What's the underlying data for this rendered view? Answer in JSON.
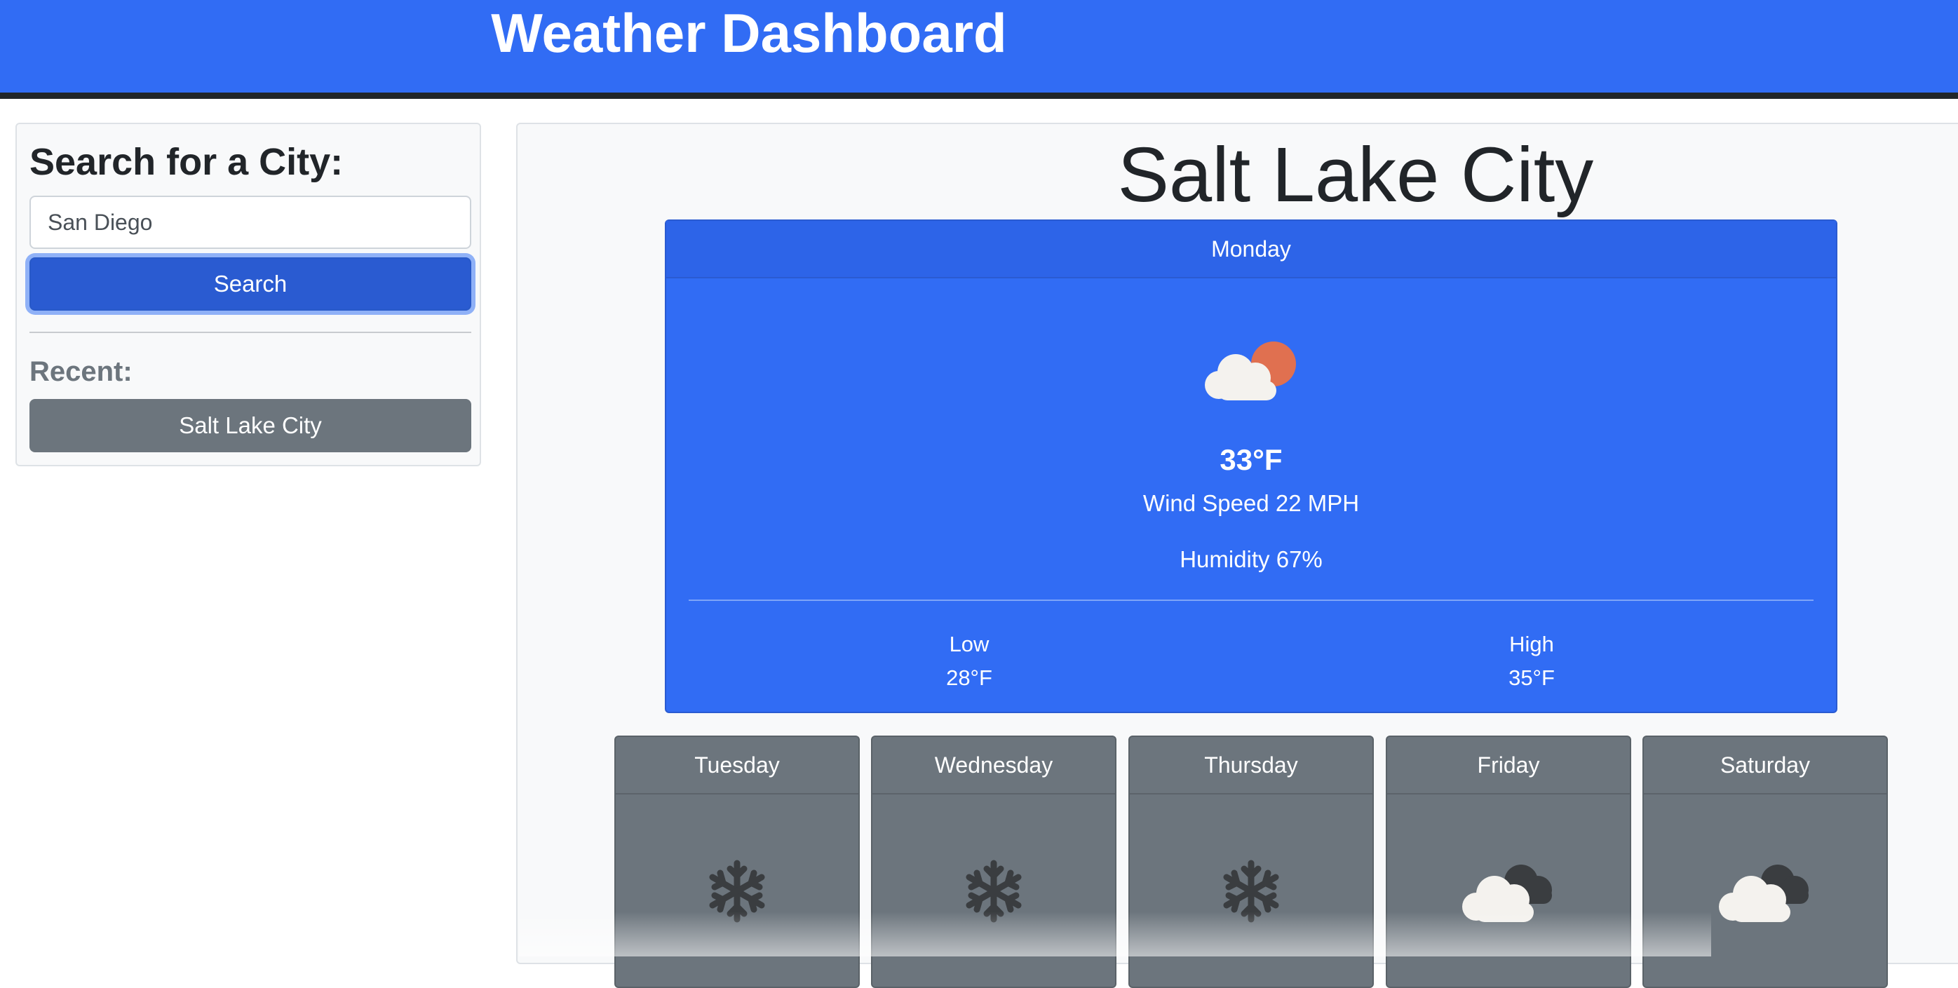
{
  "header": {
    "title": "Weather Dashboard",
    "bg_color": "#316cf4"
  },
  "sidebar": {
    "heading": "Search for a City:",
    "search_value": "San Diego",
    "search_button_label": "Search",
    "recent_label": "Recent:",
    "recent_items": [
      {
        "label": "Salt Lake City"
      }
    ]
  },
  "main": {
    "city": "Salt Lake City",
    "today": {
      "day": "Monday",
      "icon": "partly-cloudy-day-icon",
      "temperature": "33°F",
      "wind": "Wind Speed 22 MPH",
      "humidity": "Humidity 67%",
      "low_label": "Low",
      "low_value": "28°F",
      "high_label": "High",
      "high_value": "35°F",
      "card_color": "#316cf4"
    },
    "forecast": [
      {
        "day": "Tuesday",
        "icon": "snowflake-icon"
      },
      {
        "day": "Wednesday",
        "icon": "snowflake-icon"
      },
      {
        "day": "Thursday",
        "icon": "snowflake-icon"
      },
      {
        "day": "Friday",
        "icon": "cloudy-icon"
      },
      {
        "day": "Saturday",
        "icon": "cloudy-icon"
      }
    ],
    "forecast_card_color": "#6c757d"
  }
}
